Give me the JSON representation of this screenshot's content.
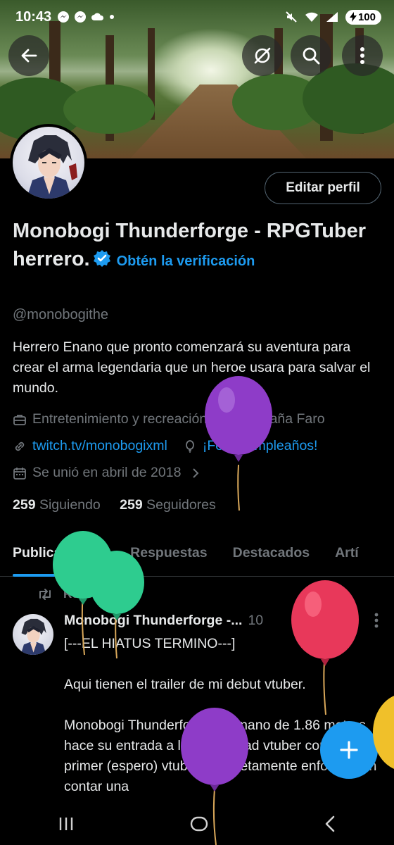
{
  "status_bar": {
    "time": "10:43",
    "notification_icons": [
      "messenger-icon",
      "messenger-icon",
      "cloud-icon",
      "dot-icon"
    ],
    "battery": "100"
  },
  "header": {
    "back_icon": "back-arrow-icon",
    "actions": [
      "no-sync-icon",
      "search-icon",
      "more-vertical-icon"
    ]
  },
  "profile": {
    "edit_button": "Editar perfil",
    "name": "Monobogi Thunderforge - RPGTuber herrero.",
    "verify_link": "Obtén la verificación",
    "handle": "@monobogithe",
    "bio": "Herrero Enano que pronto comenzará su aventura para crear el arma legendaria que un heroe usara para salvar el mundo.",
    "category": "Entretenimiento y recreación",
    "location": "Montaña Faro",
    "website": "twitch.tv/monobogixml",
    "birthday": "¡Feliz cumpleaños!",
    "joined": "Se unió en abril de 2018",
    "following_count": "259",
    "following_label": "Siguiendo",
    "followers_count": "259",
    "followers_label": "Seguidores"
  },
  "tabs": [
    "Publicaciones",
    "Respuestas",
    "Destacados",
    "Artí"
  ],
  "post": {
    "repost_label": "Reposteaste",
    "author": "Monobogi Thunderforge -...",
    "time": "10",
    "text": "[---EL HIATUS TERMINO---]\n\nAqui tienen el trailer de mi debut vtuber.\n\nMonobogi Thunderforge, el enano de 1.86 metros hace su entrada a la comunidad vtuber como el primer (espero) vtuber completamente enfocado en contar una"
  },
  "fab_icon": "plus-icon",
  "nav_bar": [
    "recent-apps-icon",
    "home-icon",
    "back-icon"
  ],
  "colors": {
    "background": "#000000",
    "accent": "#1d9bf0",
    "text": "#e7e9ea",
    "muted": "#71767b"
  },
  "decorations": {
    "balloons": [
      "purple",
      "green",
      "green",
      "red",
      "purple",
      "yellow"
    ]
  }
}
